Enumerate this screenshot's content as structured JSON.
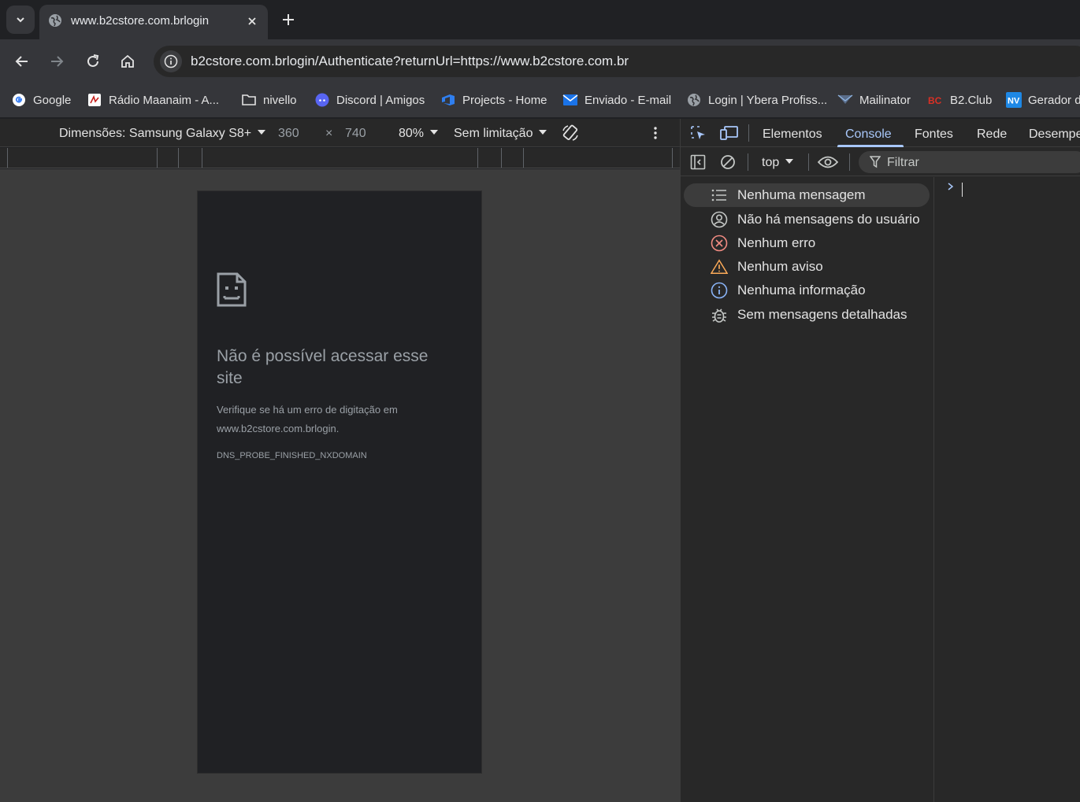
{
  "tab": {
    "title": "www.b2cstore.com.brlogin"
  },
  "omnibox": {
    "url": "b2cstore.com.brlogin/Authenticate?returnUrl=https://www.b2cstore.com.br"
  },
  "bookmarks": [
    {
      "label": "Google",
      "icon": "google-icon"
    },
    {
      "label": "Rádio Maanaim - A...",
      "icon": "radio-icon"
    },
    {
      "label": "nivello",
      "icon": "folder-icon"
    },
    {
      "label": "Discord | Amigos",
      "icon": "discord-icon"
    },
    {
      "label": "Projects - Home",
      "icon": "azure-devops-icon"
    },
    {
      "label": "Enviado - E-mail",
      "icon": "mail-icon"
    },
    {
      "label": "Login | Ybera Profiss...",
      "icon": "globe-icon"
    },
    {
      "label": "Mailinator",
      "icon": "mailinator-icon"
    },
    {
      "label": "B2.Club",
      "icon": "b2club-icon"
    },
    {
      "label": "Gerador d",
      "icon": "nv-icon"
    }
  ],
  "device_toolbar": {
    "dimensions_label": "Dimensões: Samsung Galaxy S8+",
    "width": "360",
    "times": "×",
    "height": "740",
    "zoom": "80%",
    "throttle": "Sem limitação"
  },
  "error_page": {
    "title": "Não é possível acessar esse site",
    "description": "Verifique se há um erro de digitação em www.b2cstore.com.brlogin.",
    "code": "DNS_PROBE_FINISHED_NXDOMAIN"
  },
  "devtools": {
    "tabs": [
      "Elementos",
      "Console",
      "Fontes",
      "Rede",
      "Desempe"
    ],
    "active_tab": "Console",
    "context": "top",
    "filter_placeholder": "Filtrar",
    "sidebar": [
      {
        "label": "Nenhuma mensagem",
        "icon": "list-icon"
      },
      {
        "label": "Não há mensagens do usuário",
        "icon": "user-circle-icon"
      },
      {
        "label": "Nenhum erro",
        "icon": "error-icon"
      },
      {
        "label": "Nenhum aviso",
        "icon": "warning-icon"
      },
      {
        "label": "Nenhuma informação",
        "icon": "info-icon"
      },
      {
        "label": "Sem mensagens detalhadas",
        "icon": "bug-icon"
      }
    ]
  },
  "colors": {
    "accent": "#a8c7fa",
    "error": "#f28b82",
    "warning": "#fdab58",
    "info": "#8ab4f8"
  }
}
